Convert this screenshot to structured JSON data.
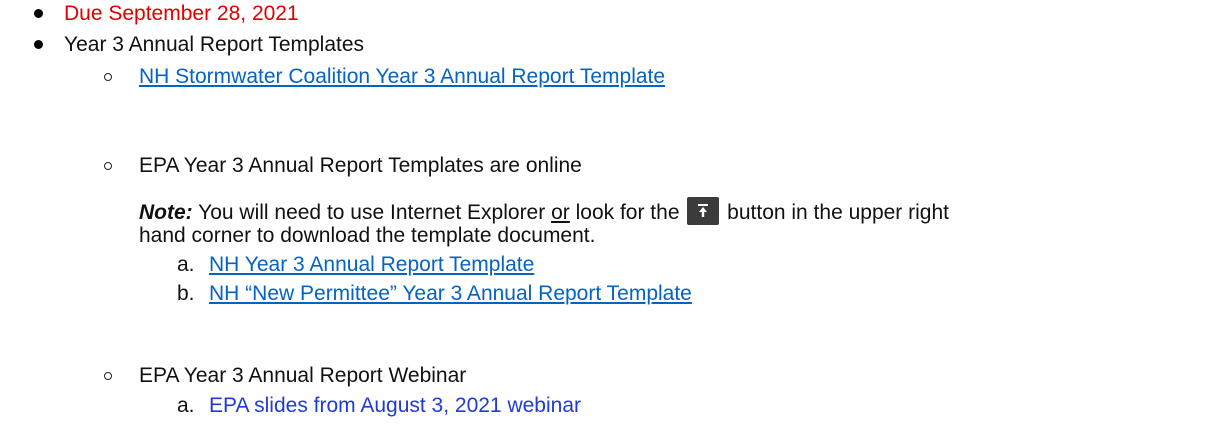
{
  "items": {
    "due": "Due September 28, 2021",
    "templates_heading": "Year 3 Annual Report Templates",
    "coalition_link": "NH Stormwater Coalition Year 3 Annual Report Template",
    "epa_online": "EPA Year 3 Annual Report Templates are online",
    "note_label": "Note:",
    "note_part1": " You will need to use Internet Explorer ",
    "note_or": "or",
    "note_part2": " look for the ",
    "note_part3": " button in the upper right",
    "note_line2": "hand corner to download the template document.",
    "sub_a_letter": "a.",
    "sub_a_link": "NH Year 3 Annual Report Template",
    "sub_b_letter": "b.",
    "sub_b_link": "NH “New Permittee” Year 3 Annual Report Template",
    "webinar": "EPA Year 3 Annual Report Webinar",
    "slides_letter": "a.",
    "slides_link": "EPA slides from August 3, 2021 webinar"
  },
  "colors": {
    "due_text": "#e00000",
    "link": "#0563c1",
    "plain_link": "#1f3bd6",
    "button_bg": "#3b3b3b"
  },
  "icons": {
    "upload_button": "upload-arrow-icon"
  }
}
